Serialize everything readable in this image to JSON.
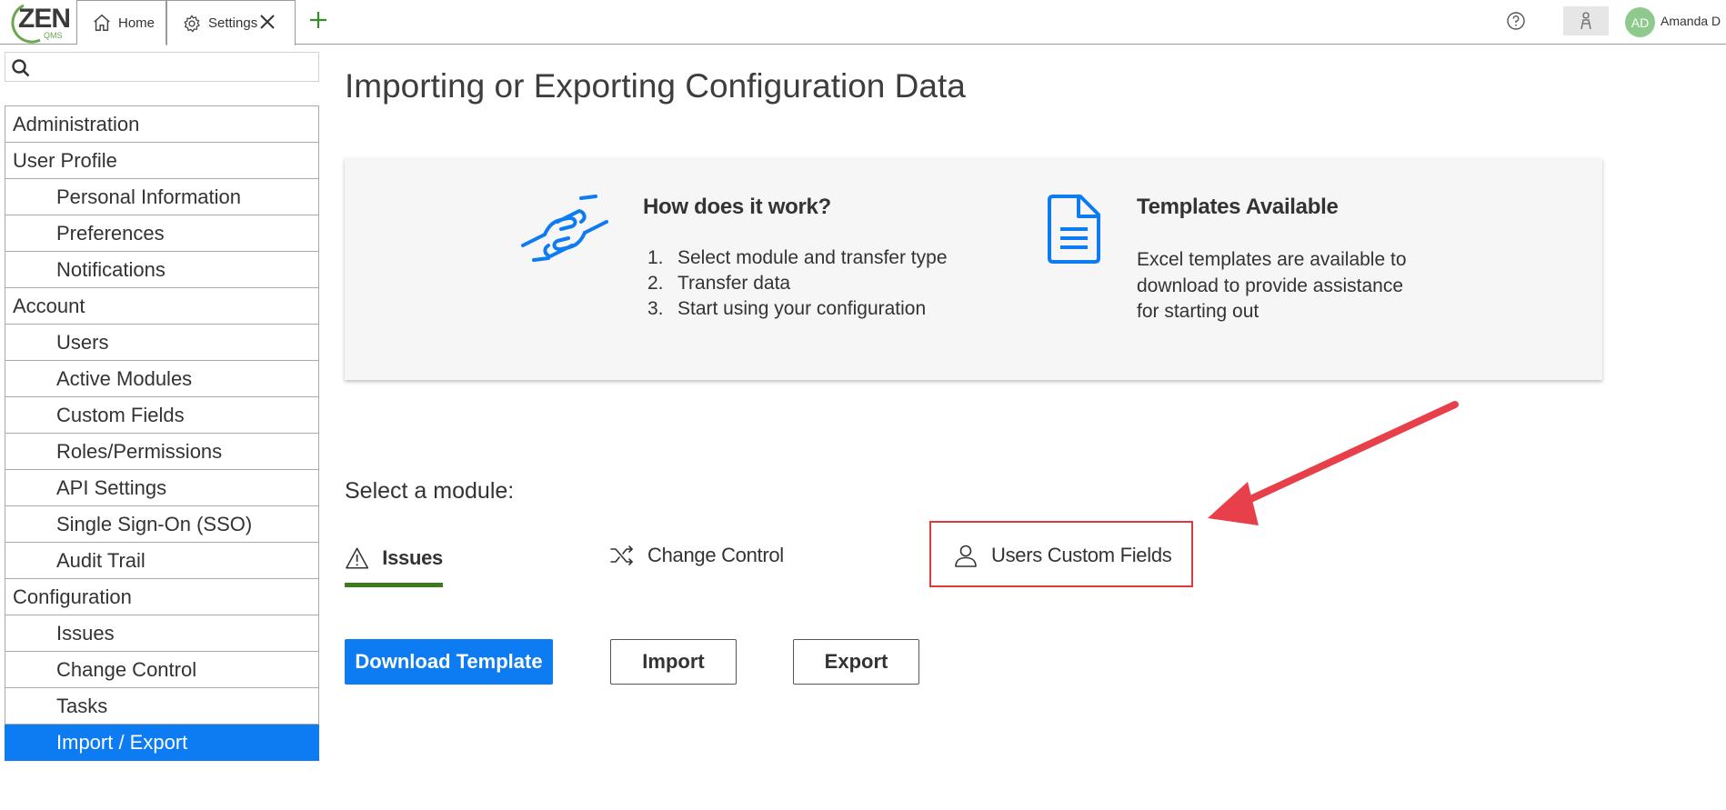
{
  "app": {
    "logo_text": "ZEN",
    "logo_sub": "QMS",
    "tabs": [
      {
        "label": "Home",
        "icon": "home-icon"
      },
      {
        "label": "Settings",
        "icon": "gear-icon"
      }
    ],
    "user_initials": "AD",
    "user_name": "Amanda D"
  },
  "sidebar": {
    "search_placeholder": "",
    "items": [
      {
        "label": "Administration",
        "level": "section"
      },
      {
        "label": "User Profile",
        "level": "section"
      },
      {
        "label": "Personal Information",
        "level": "child"
      },
      {
        "label": "Preferences",
        "level": "child"
      },
      {
        "label": "Notifications",
        "level": "child"
      },
      {
        "label": "Account",
        "level": "section"
      },
      {
        "label": "Users",
        "level": "child"
      },
      {
        "label": "Active Modules",
        "level": "child"
      },
      {
        "label": "Custom Fields",
        "level": "child"
      },
      {
        "label": "Roles/Permissions",
        "level": "child"
      },
      {
        "label": "API Settings",
        "level": "child"
      },
      {
        "label": "Single Sign-On (SSO)",
        "level": "child"
      },
      {
        "label": "Audit Trail",
        "level": "child"
      },
      {
        "label": "Configuration",
        "level": "section"
      },
      {
        "label": "Issues",
        "level": "child"
      },
      {
        "label": "Change Control",
        "level": "child"
      },
      {
        "label": "Tasks",
        "level": "child"
      },
      {
        "label": "Import / Export",
        "level": "child",
        "active": true
      }
    ]
  },
  "main": {
    "title": "Importing or Exporting Configuration Data",
    "how": {
      "title": "How does it work?",
      "steps": [
        {
          "num": "1.",
          "text": "Select module and transfer type"
        },
        {
          "num": "2.",
          "text": "Transfer data"
        },
        {
          "num": "3.",
          "text": "Start using your configuration"
        }
      ]
    },
    "templates": {
      "title": "Templates Available",
      "description": "Excel templates are available to download to provide assistance for starting out"
    },
    "select_label": "Select a module:",
    "modules": [
      {
        "label": "Issues",
        "icon": "warning-icon",
        "selected": true
      },
      {
        "label": "Change Control",
        "icon": "shuffle-icon"
      },
      {
        "label": "Users Custom Fields",
        "icon": "user-icon"
      }
    ],
    "buttons": {
      "download": "Download Template",
      "import": "Import",
      "export": "Export"
    }
  },
  "colors": {
    "accent": "#0d7bf2",
    "active_tab_underline": "#3b7d1d",
    "annotation": "#e03a3a"
  }
}
